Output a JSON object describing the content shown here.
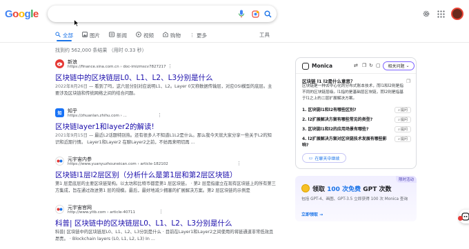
{
  "logo": {
    "letters": [
      "G",
      "o",
      "o",
      "g",
      "l",
      "e"
    ],
    "colors": [
      "#4285f4",
      "#ea4335",
      "#fbbc05",
      "#4285f4",
      "#34a853",
      "#ea4335"
    ]
  },
  "search": {
    "value": "",
    "placeholder": ""
  },
  "tabs": [
    {
      "label": "全部",
      "icon": "search-icon",
      "active": true
    },
    {
      "label": "图片",
      "icon": "image-icon"
    },
    {
      "label": "新闻",
      "icon": "news-icon"
    },
    {
      "label": "视频",
      "icon": "video-icon"
    },
    {
      "label": "购物",
      "icon": "shopping-icon"
    },
    {
      "label": "更多",
      "icon": "more-vert-icon"
    }
  ],
  "tools_label": "工具",
  "stats": "找到约 562,000 条结果 （用时 0.33 秒）",
  "results": [
    {
      "site_name": "新浪",
      "url": "https://finance.sina.com.cn › doc-imizmscv7827217",
      "title": "区块链中的区块链层L0、L1、L2、L3分别是什么",
      "date": "2022年8月26日",
      "snippet": " — 看到了吗，这六层分别对应说明L1、L2。Layer 0又称数据传输层，对应OSI模型的底层。主要涉及区块链和传统网络之间的结合问题。"
    },
    {
      "site_name": "知乎",
      "url": "https://zhuanlan.zhihu.com › ...",
      "title": "区块链layer1和layer2的解读!",
      "date": "2021年9月15日",
      "snippet": " — 最近L2话题特别热。还有很多人不知道L1L2是什么。那么我今天就大家分享一些关于L2的知识和近期行情。 Layer1和Layer2 在聊Layer2之前，不妨再来明切再 ..."
    },
    {
      "site_name": "元宇宙内参",
      "url": "https://www.yuanyuzhouneican.com › article-182102",
      "title": "区块链l1层l2层区别（分析什么是第1层和第2层区块链）",
      "date": "",
      "snippet": "第1 层是底层的主要区块链架构。以太坊和比特币都是第1 层区块链。 · 第2 层是指建立在现有区块链上的所有第三方集成，旨在通过改进第1 层的规模。最后，最好地减少拥塞的扩展解决方案。第2 层区块链的示例是Optimism、..."
    },
    {
      "site_name": "元宇宙官网",
      "url": "http://www.yitb.com › article-40711",
      "title": "科普| 区块链中的区块链层L0、L1、L2、L3分别是什么",
      "date": "",
      "snippet": "科普| 区块链中的区块链层L0、L1、L2、L3分别是什么 · 目前在Layer1和Layer2之间使用的将链通道非常低效且昂贵。 · Blockchain layers (L0, L1, L2, L3) In ..."
    }
  ],
  "monica": {
    "name": "Monica",
    "related_label": "相关问题",
    "question": "区块链 l1 l2是什么意思？",
    "answer": "区块链是一种去中心化的分布式账本技术，而l1和l2则是指不同的区块链层级。l1指的是基础层区块链，而l2则是指基于l1之上的二层扩展解决方案。",
    "items": [
      "1. 区块链l1和l2有哪些区别?",
      "2. l2扩展解决方案有哪些常见的类型?",
      "3. 区块链l1和l2的应用场景有哪些?",
      "4. l2扩展解决方案对区块链技术发展有哪些影响?"
    ],
    "ask_label": "提问",
    "chat_label": "在聊天中继续"
  },
  "promo": {
    "badge": "限时活动",
    "title_prefix": "领取",
    "title_count": "100 次免费",
    "title_suffix": "GPT 次数",
    "desc": "包括 GPT-4、画图、GPT-3.5 立即获得 100 次 Monica 查询",
    "link": "立即领取 →"
  }
}
